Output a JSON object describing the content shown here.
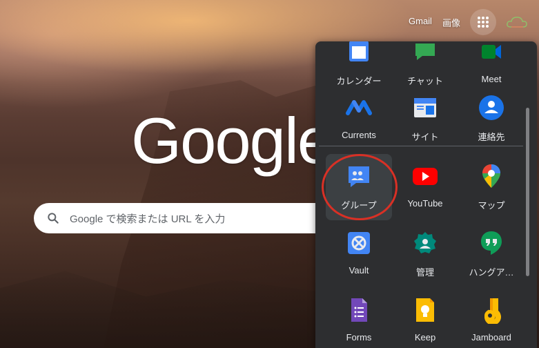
{
  "topbar": {
    "gmail": "Gmail",
    "images": "画像"
  },
  "logo": "Google",
  "search": {
    "placeholder": "Google で検索または URL を入力"
  },
  "apps": [
    {
      "label": "カレンダー",
      "icon": "calendar-icon"
    },
    {
      "label": "チャット",
      "icon": "chat-icon"
    },
    {
      "label": "Meet",
      "icon": "meet-icon"
    },
    {
      "label": "Currents",
      "icon": "currents-icon"
    },
    {
      "label": "サイト",
      "icon": "sites-icon"
    },
    {
      "label": "連絡先",
      "icon": "contacts-icon"
    },
    {
      "label": "グループ",
      "icon": "groups-icon"
    },
    {
      "label": "YouTube",
      "icon": "youtube-icon"
    },
    {
      "label": "マップ",
      "icon": "maps-icon"
    },
    {
      "label": "Vault",
      "icon": "vault-icon"
    },
    {
      "label": "管理",
      "icon": "admin-icon"
    },
    {
      "label": "ハングア…",
      "icon": "hangouts-icon"
    },
    {
      "label": "Forms",
      "icon": "forms-icon"
    },
    {
      "label": "Keep",
      "icon": "keep-icon"
    },
    {
      "label": "Jamboard",
      "icon": "jamboard-icon"
    }
  ],
  "colors": {
    "panel": "#2d2e30",
    "highlight_ring": "#d93025",
    "label": "#e8eaed"
  }
}
